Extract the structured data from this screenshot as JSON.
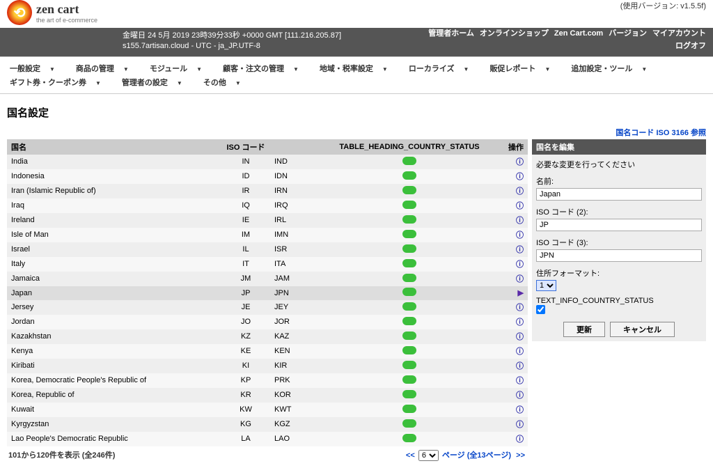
{
  "header": {
    "logo_main": "zen cart",
    "logo_tag": "the art of e-commerce",
    "version_label": "(使用バージョン: v1.5.5f)",
    "server_line1": "金曜日 24 5月 2019 23時39分33秒 +0000 GMT [111.216.205.87]",
    "server_line2": "s155.7artisan.cloud - UTC - ja_JP.UTF-8",
    "admin_links_row1": [
      "管理者ホーム",
      "オンラインショップ",
      "Zen Cart.com",
      "バージョン",
      "マイアカウント"
    ],
    "admin_links_row2": [
      "ログオフ"
    ]
  },
  "menu": [
    "一般設定",
    "商品の管理",
    "モジュール",
    "顧客・注文の管理",
    "地域・税率設定",
    "ローカライズ",
    "販促レポート",
    "追加設定・ツール",
    "ギフト券・クーポン券",
    "管理者の設定",
    "その他"
  ],
  "page_title": "国名設定",
  "iso_ref": "国名コード ISO 3166 参照",
  "table": {
    "cols": {
      "name": "国名",
      "iso": "ISO コード",
      "status": "TABLE_HEADING_COUNTRY_STATUS",
      "action": "操作"
    },
    "rows": [
      {
        "name": "India",
        "iso2": "IN",
        "iso3": "IND",
        "selected": false
      },
      {
        "name": "Indonesia",
        "iso2": "ID",
        "iso3": "IDN",
        "selected": false
      },
      {
        "name": "Iran (Islamic Republic of)",
        "iso2": "IR",
        "iso3": "IRN",
        "selected": false
      },
      {
        "name": "Iraq",
        "iso2": "IQ",
        "iso3": "IRQ",
        "selected": false
      },
      {
        "name": "Ireland",
        "iso2": "IE",
        "iso3": "IRL",
        "selected": false
      },
      {
        "name": "Isle of Man",
        "iso2": "IM",
        "iso3": "IMN",
        "selected": false
      },
      {
        "name": "Israel",
        "iso2": "IL",
        "iso3": "ISR",
        "selected": false
      },
      {
        "name": "Italy",
        "iso2": "IT",
        "iso3": "ITA",
        "selected": false
      },
      {
        "name": "Jamaica",
        "iso2": "JM",
        "iso3": "JAM",
        "selected": false
      },
      {
        "name": "Japan",
        "iso2": "JP",
        "iso3": "JPN",
        "selected": true
      },
      {
        "name": "Jersey",
        "iso2": "JE",
        "iso3": "JEY",
        "selected": false
      },
      {
        "name": "Jordan",
        "iso2": "JO",
        "iso3": "JOR",
        "selected": false
      },
      {
        "name": "Kazakhstan",
        "iso2": "KZ",
        "iso3": "KAZ",
        "selected": false
      },
      {
        "name": "Kenya",
        "iso2": "KE",
        "iso3": "KEN",
        "selected": false
      },
      {
        "name": "Kiribati",
        "iso2": "KI",
        "iso3": "KIR",
        "selected": false
      },
      {
        "name": "Korea, Democratic People's Republic of",
        "iso2": "KP",
        "iso3": "PRK",
        "selected": false
      },
      {
        "name": "Korea, Republic of",
        "iso2": "KR",
        "iso3": "KOR",
        "selected": false
      },
      {
        "name": "Kuwait",
        "iso2": "KW",
        "iso3": "KWT",
        "selected": false
      },
      {
        "name": "Kyrgyzstan",
        "iso2": "KG",
        "iso3": "KGZ",
        "selected": false
      },
      {
        "name": "Lao People's Democratic Republic",
        "iso2": "LA",
        "iso3": "LAO",
        "selected": false
      }
    ]
  },
  "pager": {
    "display_left": "101から120件を表示 (全246件)",
    "page_value": "6",
    "page_suffix": "ページ (全13ページ)",
    "prev": "<<",
    "next": ">>"
  },
  "edit": {
    "heading": "国名を編集",
    "instr": "必要な変更を行ってください",
    "label_name": "名前:",
    "val_name": "Japan",
    "label_iso2": "ISO コード (2):",
    "val_iso2": "JP",
    "label_iso3": "ISO コード (3):",
    "val_iso3": "JPN",
    "label_format": "住所フォーマット:",
    "val_format": "1",
    "label_status": "TEXT_INFO_COUNTRY_STATUS",
    "btn_update": "更新",
    "btn_cancel": "キャンセル"
  }
}
